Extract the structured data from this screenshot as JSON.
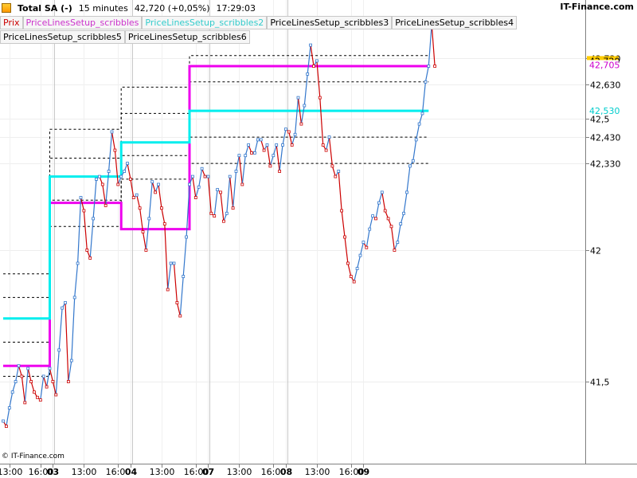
{
  "header": {
    "instrument": "Total SA (-)",
    "timeframe": "15 minutes",
    "last": "42,720 (+0,05%)",
    "time": "17:29:03",
    "brand": "IT-Finance.com"
  },
  "legend": [
    {
      "label": "Prix",
      "color": "#cc0000"
    },
    {
      "label": "PriceLinesSetup_scribbles",
      "color": "#cc33cc"
    },
    {
      "label": "PriceLinesSetup_scribbles2",
      "color": "#33cccc"
    },
    {
      "label": "PriceLinesSetup_scribbles3",
      "color": "#000000"
    },
    {
      "label": "PriceLinesSetup_scribbles4",
      "color": "#000000"
    },
    {
      "label": "PriceLinesSetup_scribbles5",
      "color": "#000000"
    },
    {
      "label": "PriceLinesSetup_scribbles6",
      "color": "#000000"
    }
  ],
  "copyright": "© IT-Finance.com",
  "chart_data": {
    "type": "line",
    "ylim": [
      41.27,
      42.86
    ],
    "y_ticks": [
      {
        "value": 42.73,
        "label": "42,730"
      },
      {
        "value": 42.63,
        "label": "42,630"
      },
      {
        "value": 42.5,
        "label": "42,5"
      },
      {
        "value": 42.43,
        "label": "42,430"
      },
      {
        "value": 42.33,
        "label": "42,330"
      },
      {
        "value": 42.0,
        "label": "42"
      },
      {
        "value": 41.5,
        "label": "41,5"
      }
    ],
    "price_badges": [
      {
        "value": 42.72,
        "label": "42,720",
        "color": "#ffcc00",
        "text_color": "#000000"
      },
      {
        "value": 42.705,
        "label": "42,705",
        "color": "#ffffff",
        "text_color": "#cc00cc"
      },
      {
        "value": 42.53,
        "label": "42,530",
        "color": "#ffffff",
        "text_color": "#00cccc"
      }
    ],
    "x_tick_labels": [
      {
        "bar": 2,
        "label": "13:00",
        "bold": false
      },
      {
        "bar": 12,
        "label": "16:00",
        "bold": false
      },
      {
        "bar": 16,
        "label": "03",
        "bold": true
      },
      {
        "bar": 26,
        "label": "13:00",
        "bold": false
      },
      {
        "bar": 37,
        "label": "16:00",
        "bold": false
      },
      {
        "bar": 41,
        "label": "04",
        "bold": true
      },
      {
        "bar": 51,
        "label": "13:00",
        "bold": false
      },
      {
        "bar": 62,
        "label": "16:00",
        "bold": false
      },
      {
        "bar": 66,
        "label": "07",
        "bold": true
      },
      {
        "bar": 76,
        "label": "13:00",
        "bold": false
      },
      {
        "bar": 87,
        "label": "16:00",
        "bold": false
      },
      {
        "bar": 91,
        "label": "08",
        "bold": true
      },
      {
        "bar": 101,
        "label": "13:00",
        "bold": false
      },
      {
        "bar": 112,
        "label": "16:00",
        "bold": false
      },
      {
        "bar": 116,
        "label": "09",
        "bold": true
      }
    ],
    "day_separators": [
      16.5,
      41.5,
      66.5,
      91.5
    ],
    "series": [
      {
        "role": "price",
        "up_color": "#3377cc",
        "down_color": "#cc0000",
        "values": [
          41.35,
          41.33,
          41.4,
          41.46,
          41.5,
          41.56,
          41.52,
          41.42,
          41.55,
          41.5,
          41.46,
          41.44,
          41.43,
          41.52,
          41.48,
          41.55,
          41.5,
          41.45,
          41.62,
          41.78,
          41.8,
          41.5,
          41.58,
          41.82,
          41.95,
          42.2,
          42.15,
          42.0,
          41.97,
          42.12,
          42.27,
          42.28,
          42.25,
          42.17,
          42.3,
          42.45,
          42.38,
          42.25,
          42.28,
          42.3,
          42.33,
          42.27,
          42.2,
          42.21,
          42.16,
          42.07,
          42.0,
          42.12,
          42.26,
          42.22,
          42.25,
          42.16,
          42.1,
          41.85,
          41.95,
          41.95,
          41.8,
          41.75,
          41.9,
          42.05,
          42.25,
          42.28,
          42.2,
          42.24,
          42.31,
          42.28,
          42.28,
          42.14,
          42.13,
          42.23,
          42.22,
          42.11,
          42.14,
          42.28,
          42.16,
          42.3,
          42.36,
          42.25,
          42.36,
          42.4,
          42.37,
          42.37,
          42.42,
          42.42,
          42.38,
          42.4,
          42.32,
          42.36,
          42.4,
          42.3,
          42.4,
          42.46,
          42.45,
          42.4,
          42.44,
          42.58,
          42.48,
          42.55,
          42.67,
          42.78,
          42.7,
          42.72,
          42.58,
          42.4,
          42.38,
          42.43,
          42.32,
          42.28,
          42.3,
          42.15,
          42.05,
          41.95,
          41.9,
          41.88,
          41.93,
          41.98,
          42.03,
          42.01,
          42.08,
          42.13,
          42.12,
          42.18,
          42.22,
          42.15,
          42.12,
          42.09,
          42.0,
          42.03,
          42.1,
          42.14,
          42.22,
          42.32,
          42.34,
          42.42,
          42.48,
          42.52,
          42.64,
          42.7,
          42.86,
          42.7
        ]
      },
      {
        "role": "line",
        "name": "PriceLinesSetup_scribbles",
        "color": "#ee00ee",
        "width": 3,
        "steps": [
          [
            0,
            41.56
          ],
          [
            15,
            41.56
          ],
          [
            15,
            42.18
          ],
          [
            38,
            42.18
          ],
          [
            38,
            42.08
          ],
          [
            60,
            42.08
          ],
          [
            60,
            42.7
          ]
        ],
        "x_end": 137
      },
      {
        "role": "line",
        "name": "PriceLinesSetup_scribbles2",
        "color": "#00eeee",
        "width": 3,
        "steps": [
          [
            0,
            41.74
          ],
          [
            15,
            41.74
          ],
          [
            15,
            42.28
          ],
          [
            38,
            42.28
          ],
          [
            38,
            42.41
          ],
          [
            60,
            42.41
          ],
          [
            60,
            42.53
          ]
        ],
        "x_end": 137
      },
      {
        "role": "dashed",
        "name": "PriceLinesSetup_scribbles3",
        "color": "#000000",
        "steps": [
          [
            0,
            41.91
          ],
          [
            15,
            41.91
          ],
          [
            15,
            42.46
          ],
          [
            38,
            42.46
          ],
          [
            38,
            42.62
          ],
          [
            60,
            42.62
          ],
          [
            60,
            42.74
          ]
        ],
        "x_end": 137
      },
      {
        "role": "dashed",
        "name": "PriceLinesSetup_scribbles4",
        "color": "#000000",
        "steps": [
          [
            0,
            41.82
          ],
          [
            15,
            41.82
          ],
          [
            15,
            42.35
          ],
          [
            38,
            42.35
          ],
          [
            38,
            42.52
          ],
          [
            60,
            42.52
          ],
          [
            60,
            42.64
          ]
        ],
        "x_end": 137
      },
      {
        "role": "dashed",
        "name": "PriceLinesSetup_scribbles5",
        "color": "#000000",
        "steps": [
          [
            0,
            41.65
          ],
          [
            15,
            41.65
          ],
          [
            15,
            42.19
          ],
          [
            38,
            42.19
          ],
          [
            38,
            42.36
          ],
          [
            60,
            42.36
          ],
          [
            60,
            42.43
          ]
        ],
        "x_end": 137
      },
      {
        "role": "dashed",
        "name": "PriceLinesSetup_scribbles6",
        "color": "#000000",
        "steps": [
          [
            0,
            41.52
          ],
          [
            15,
            41.52
          ],
          [
            15,
            42.09
          ],
          [
            38,
            42.09
          ],
          [
            38,
            42.27
          ],
          [
            60,
            42.27
          ],
          [
            60,
            42.33
          ]
        ],
        "x_end": 137
      }
    ]
  }
}
